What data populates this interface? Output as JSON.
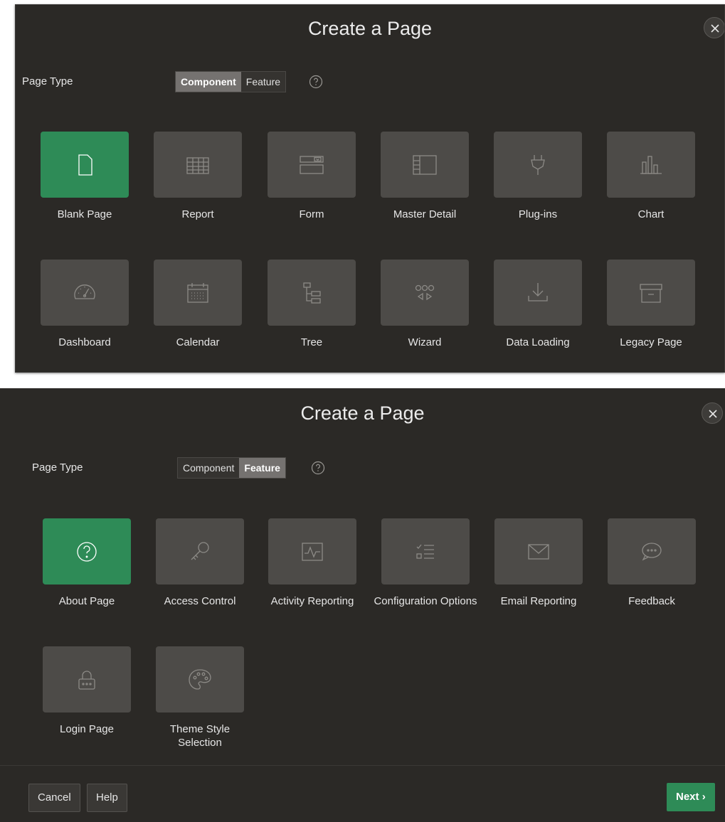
{
  "dialog1": {
    "title": "Create a Page",
    "page_type_label": "Page Type",
    "segmented": {
      "component": "Component",
      "feature": "Feature",
      "active": "component"
    },
    "tiles": [
      {
        "label": "Blank Page",
        "icon": "document-icon",
        "selected": true
      },
      {
        "label": "Report",
        "icon": "table-icon"
      },
      {
        "label": "Form",
        "icon": "form-icon"
      },
      {
        "label": "Master Detail",
        "icon": "master-detail-icon"
      },
      {
        "label": "Plug-ins",
        "icon": "plug-icon"
      },
      {
        "label": "Chart",
        "icon": "bar-chart-icon"
      },
      {
        "label": "Dashboard",
        "icon": "gauge-icon"
      },
      {
        "label": "Calendar",
        "icon": "calendar-icon"
      },
      {
        "label": "Tree",
        "icon": "tree-icon"
      },
      {
        "label": "Wizard",
        "icon": "wizard-icon"
      },
      {
        "label": "Data Loading",
        "icon": "download-icon"
      },
      {
        "label": "Legacy Page",
        "icon": "archive-icon"
      }
    ]
  },
  "dialog2": {
    "title": "Create a Page",
    "page_type_label": "Page Type",
    "segmented": {
      "component": "Component",
      "feature": "Feature",
      "active": "feature"
    },
    "tiles": [
      {
        "label": "About Page",
        "icon": "question-circle-icon",
        "selected": true
      },
      {
        "label": "Access Control",
        "icon": "key-icon"
      },
      {
        "label": "Activity Reporting",
        "icon": "activity-icon"
      },
      {
        "label": "Configuration Options",
        "icon": "checklist-icon"
      },
      {
        "label": "Email Reporting",
        "icon": "envelope-icon"
      },
      {
        "label": "Feedback",
        "icon": "speech-bubble-icon"
      },
      {
        "label": "Login Page",
        "icon": "lock-icon"
      },
      {
        "label": "Theme Style Selection",
        "icon": "palette-icon"
      }
    ],
    "footer": {
      "cancel": "Cancel",
      "help": "Help",
      "next": "Next"
    }
  },
  "colors": {
    "dialog_bg": "#2b2926",
    "tile_bg": "#4d4b48",
    "accent": "#2e8b57"
  }
}
